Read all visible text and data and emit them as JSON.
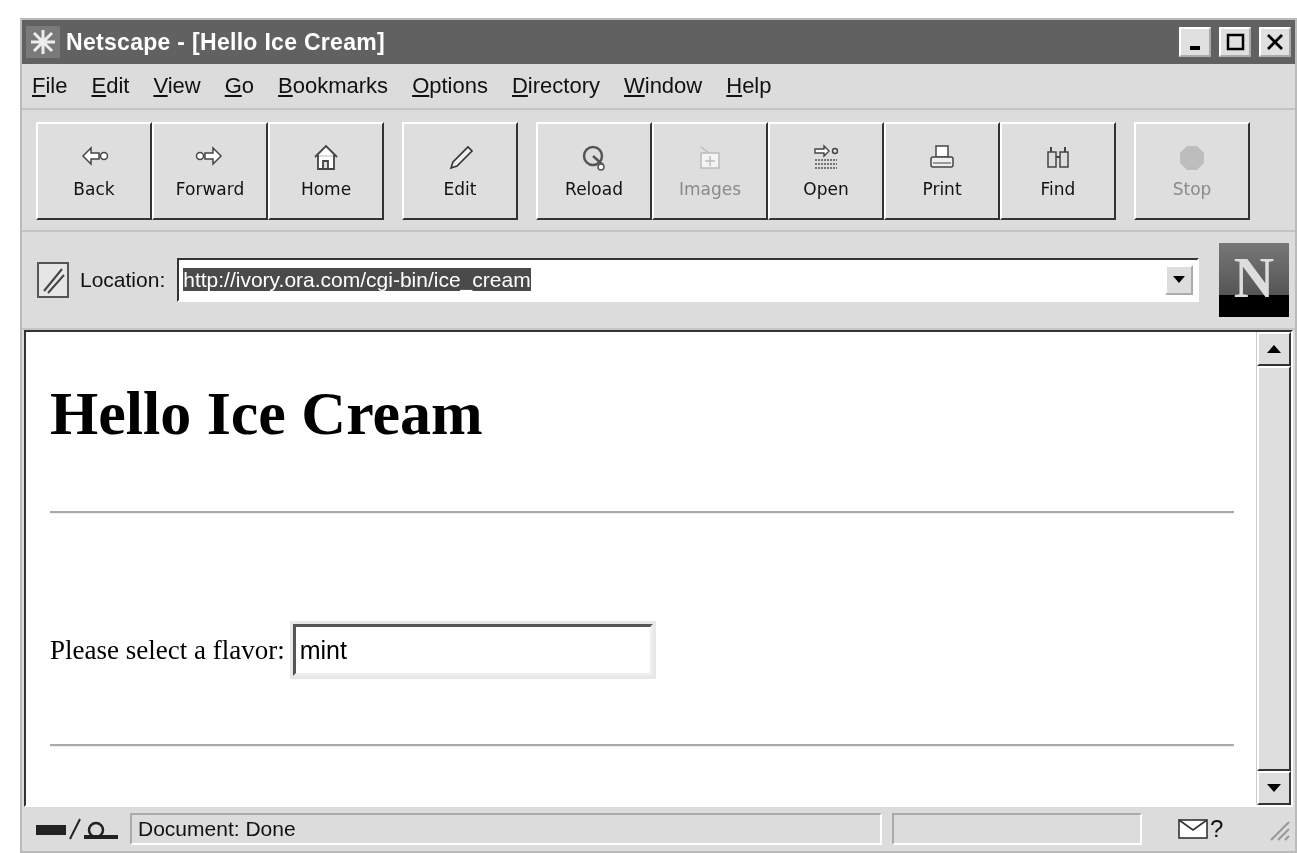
{
  "window": {
    "title": "Netscape - [Hello Ice Cream]",
    "controls": [
      {
        "kind": "minimize"
      },
      {
        "kind": "maximize"
      },
      {
        "kind": "close"
      }
    ]
  },
  "menu": [
    {
      "mnemonic": "F",
      "rest": "ile"
    },
    {
      "mnemonic": "E",
      "rest": "dit"
    },
    {
      "mnemonic": "V",
      "rest": "iew"
    },
    {
      "mnemonic": "G",
      "rest": "o"
    },
    {
      "mnemonic": "B",
      "rest": "ookmarks"
    },
    {
      "mnemonic": "O",
      "rest": "ptions"
    },
    {
      "mnemonic": "D",
      "rest": "irectory"
    },
    {
      "mnemonic": "W",
      "rest": "indow"
    },
    {
      "mnemonic": "H",
      "rest": "elp"
    }
  ],
  "toolbar": [
    [
      {
        "kind": "back",
        "label": "Back",
        "disabled": false
      },
      {
        "kind": "forward",
        "label": "Forward",
        "disabled": false
      },
      {
        "kind": "home",
        "label": "Home",
        "disabled": false
      }
    ],
    [
      {
        "kind": "edit",
        "label": "Edit",
        "disabled": false
      }
    ],
    [
      {
        "kind": "reload",
        "label": "Reload",
        "disabled": false
      },
      {
        "kind": "images",
        "label": "Images",
        "disabled": true
      },
      {
        "kind": "open",
        "label": "Open",
        "disabled": false
      },
      {
        "kind": "print",
        "label": "Print",
        "disabled": false
      },
      {
        "kind": "find",
        "label": "Find",
        "disabled": false
      }
    ],
    [
      {
        "kind": "stop",
        "label": "Stop",
        "disabled": true
      }
    ]
  ],
  "location": {
    "label": "Location:",
    "value": "http://ivory.ora.com/cgi-bin/ice_cream",
    "selected": true
  },
  "logo": {
    "letter": "N"
  },
  "page": {
    "heading": "Hello Ice Cream",
    "prompt": "Please select a flavor:",
    "flavor_value": "mint"
  },
  "status_bar": {
    "message": "Document: Done",
    "mail_status": "?"
  }
}
